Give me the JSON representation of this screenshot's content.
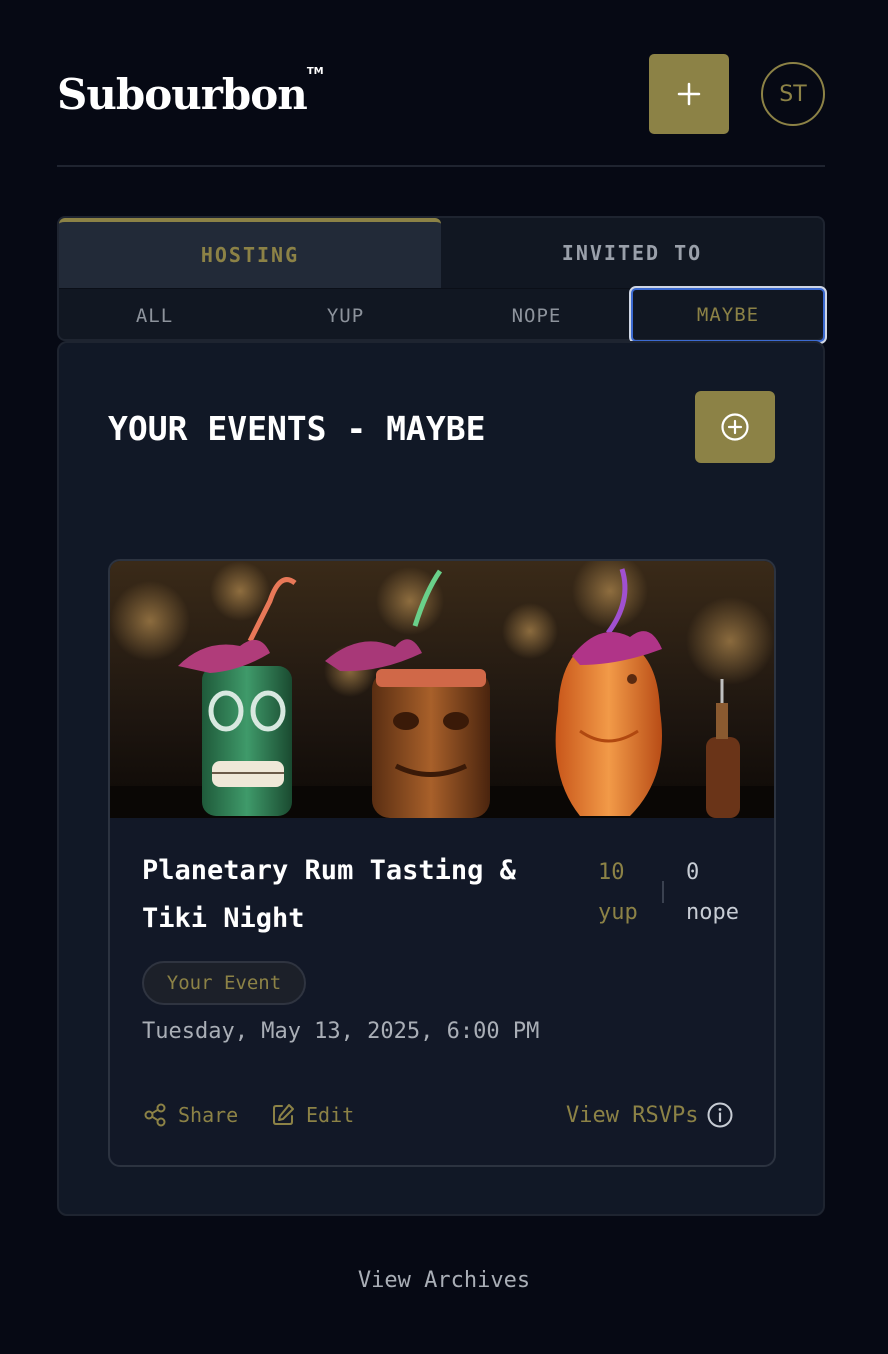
{
  "header": {
    "logo": "Subourbon",
    "logo_mark": "TM",
    "add_icon": "plus-icon",
    "avatar_initials": "ST"
  },
  "tabs": {
    "main": [
      {
        "label": "HOSTING",
        "active": true
      },
      {
        "label": "INVITED TO",
        "active": false
      }
    ],
    "sub": [
      {
        "label": "ALL",
        "active": false
      },
      {
        "label": "YUP",
        "active": false
      },
      {
        "label": "NOPE",
        "active": false
      },
      {
        "label": "MAYBE",
        "active": true
      }
    ]
  },
  "panel": {
    "title": "YOUR EVENTS - MAYBE",
    "add_icon": "circle-plus-icon"
  },
  "event": {
    "image": "tiki-mugs-photo",
    "title": "Planetary Rum Tasting & Tiki Night",
    "yup_count": "10",
    "yup_label": "yup",
    "nope_count": "0",
    "nope_label": "nope",
    "badge": "Your Event",
    "date": "Tuesday, May 13, 2025, 6:00 PM",
    "share_label": "Share",
    "edit_label": "Edit",
    "rsvps_label": "View RSVPs"
  },
  "footer": {
    "archives_label": "View Archives"
  },
  "colors": {
    "background": "#060914",
    "accent": "#8c8246",
    "panel": "#111826",
    "focus": "#3c6ad0"
  }
}
